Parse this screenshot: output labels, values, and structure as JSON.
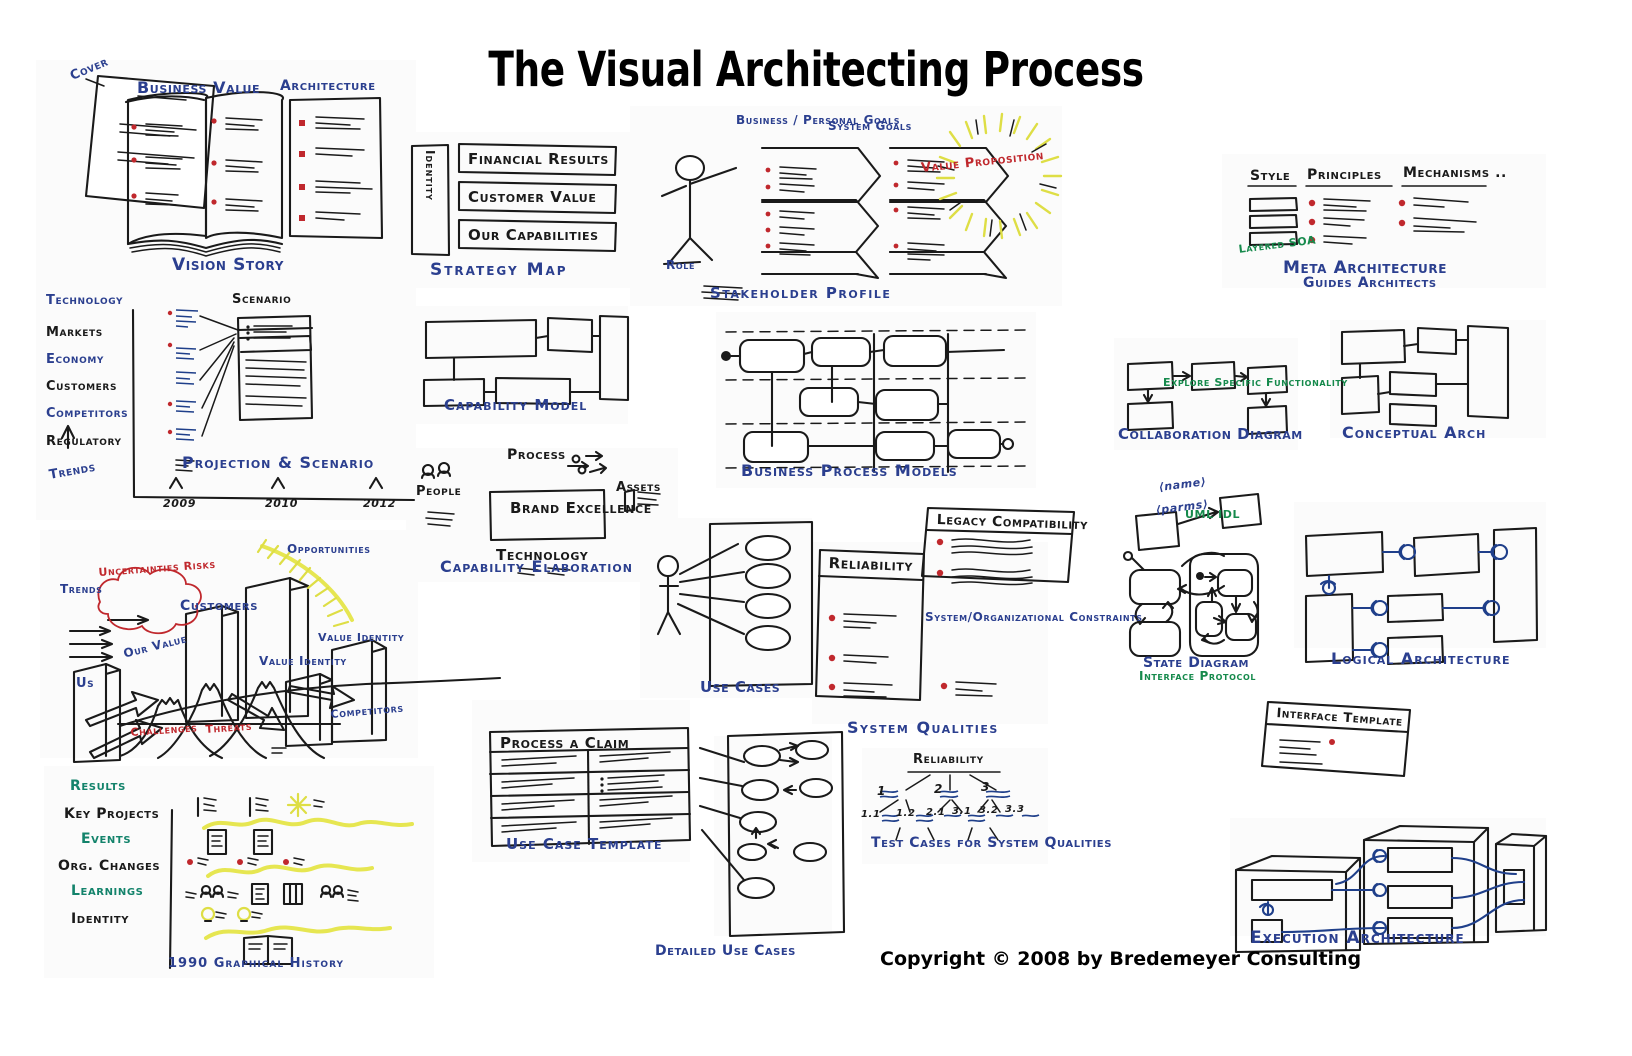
{
  "page": {
    "title": "The Visual Architecting Process",
    "copyright": "Copyright © 2008 by Bredemeyer Consulting",
    "background": "#ffffff",
    "ink_colors": {
      "blue": "#2b3f8f",
      "black": "#1a1a1a",
      "red": "#c0282d",
      "green": "#168a4c",
      "teal": "#13836b",
      "yellow": "#e8e84a",
      "line_blue": "#1f3f8a"
    }
  },
  "panels": {
    "vision_story": {
      "caption": "Vision Story",
      "labels": {
        "cover": "Cover",
        "business_value": "Business Value",
        "architecture": "Architecture"
      }
    },
    "strategy_map": {
      "caption": "Strategy Map",
      "side_label": "Identity",
      "rows": [
        "Financial Results",
        "Customer Value",
        "Our Capabilities"
      ]
    },
    "stakeholder_profile": {
      "caption": "Stakeholder Profile",
      "role_label": "Role",
      "column_1": "Business / Personal Goals",
      "column_2": "System Goals",
      "outcome": "Value Proposition"
    },
    "meta_architecture": {
      "caption": "Meta Architecture",
      "subcaption": "Guides Architects",
      "columns": [
        "Style",
        "Principles",
        "Mechanisms .."
      ],
      "style_note": "Layered SOA"
    },
    "projection_scenario": {
      "caption": "Projection & Scenario",
      "scenario_label": "Scenario",
      "axis_label": "Trends",
      "categories": [
        "Technology",
        "Markets",
        "Economy",
        "Customers",
        "Competitors",
        "Regulatory"
      ],
      "years": [
        "2009",
        "2010",
        "2012"
      ]
    },
    "capability_model": {
      "caption": "Capability Model"
    },
    "capability_elaboration": {
      "caption": "Capability Elaboration",
      "center": "Brand Excellence",
      "top": "Process",
      "bottom": "Technology",
      "left": "People",
      "right": "Assets"
    },
    "business_process_models": {
      "caption": "Business Process Models"
    },
    "collaboration_diagram": {
      "caption": "Collaboration Diagram",
      "note": "Explore Specific Functionality"
    },
    "conceptual_arch": {
      "caption": "Conceptual Arch"
    },
    "landscape": {
      "labels": {
        "trends": "Trends",
        "uncertainties": "Uncertainties Risks",
        "opportunities": "Opportunities",
        "customers": "Customers",
        "us": "Us",
        "our_value": "Our Value",
        "value_identity_1": "Value Identity",
        "value_identity_2": "Value Identity",
        "competitors": "Competitors",
        "challenges": "Challenges",
        "threats": "Threats"
      }
    },
    "use_cases": {
      "caption": "Use Cases"
    },
    "system_qualities": {
      "caption": "System Qualities",
      "card_reliability": "Reliability",
      "card_legacy": "Legacy Compatibility",
      "constraints_note": "System/Organizational Constraints"
    },
    "state_diagram": {
      "caption": "State Diagram",
      "subcaption": "Interface Protocol",
      "name_label": "⟨name⟩",
      "parms_label": "⟨parms⟩",
      "tech_note": "UML IDL"
    },
    "logical_architecture": {
      "caption": "Logical Architecture"
    },
    "interface_template": {
      "caption": "Interface Template"
    },
    "use_case_template": {
      "caption": "Use Case Template",
      "header": "Process a Claim"
    },
    "detailed_use_cases": {
      "caption": "Detailed Use Cases"
    },
    "test_cases": {
      "caption": "Test Cases for System Qualities",
      "root": "Reliability",
      "level1": [
        "1",
        "2",
        "3"
      ],
      "level2": [
        "1.1",
        "1.2",
        "2.1",
        "3.1",
        "3.2",
        "3.3"
      ]
    },
    "graphical_history": {
      "caption": "1990 Graphical History",
      "rows": [
        "Results",
        "Key Projects",
        "Events",
        "Org. Changes",
        "Learnings",
        "Identity"
      ],
      "row_colors": [
        "teal",
        "black",
        "teal",
        "black",
        "teal",
        "black"
      ]
    },
    "execution_architecture": {
      "caption": "Execution Architecture"
    }
  }
}
